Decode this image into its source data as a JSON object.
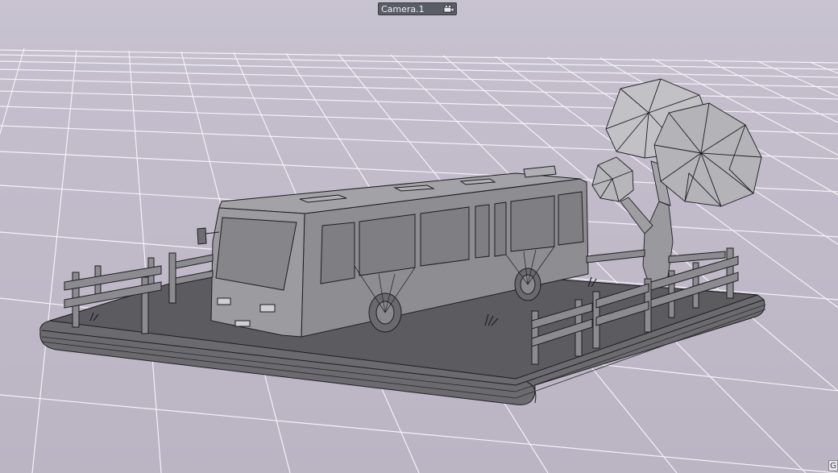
{
  "viewport": {
    "camera_label": "Camera.1",
    "camera_icon": "camera-icon",
    "corner_tag": "G"
  },
  "colors": {
    "background": "#c3bdcc",
    "grid_line": "#f2f0f5",
    "base_top": "#5f5f62",
    "base_rim": "#7a7a7e",
    "wire": "#1e1e22",
    "bus_body": "#8d8d90",
    "tree": "#a9a9ad",
    "fence": "#8a8a8d"
  }
}
